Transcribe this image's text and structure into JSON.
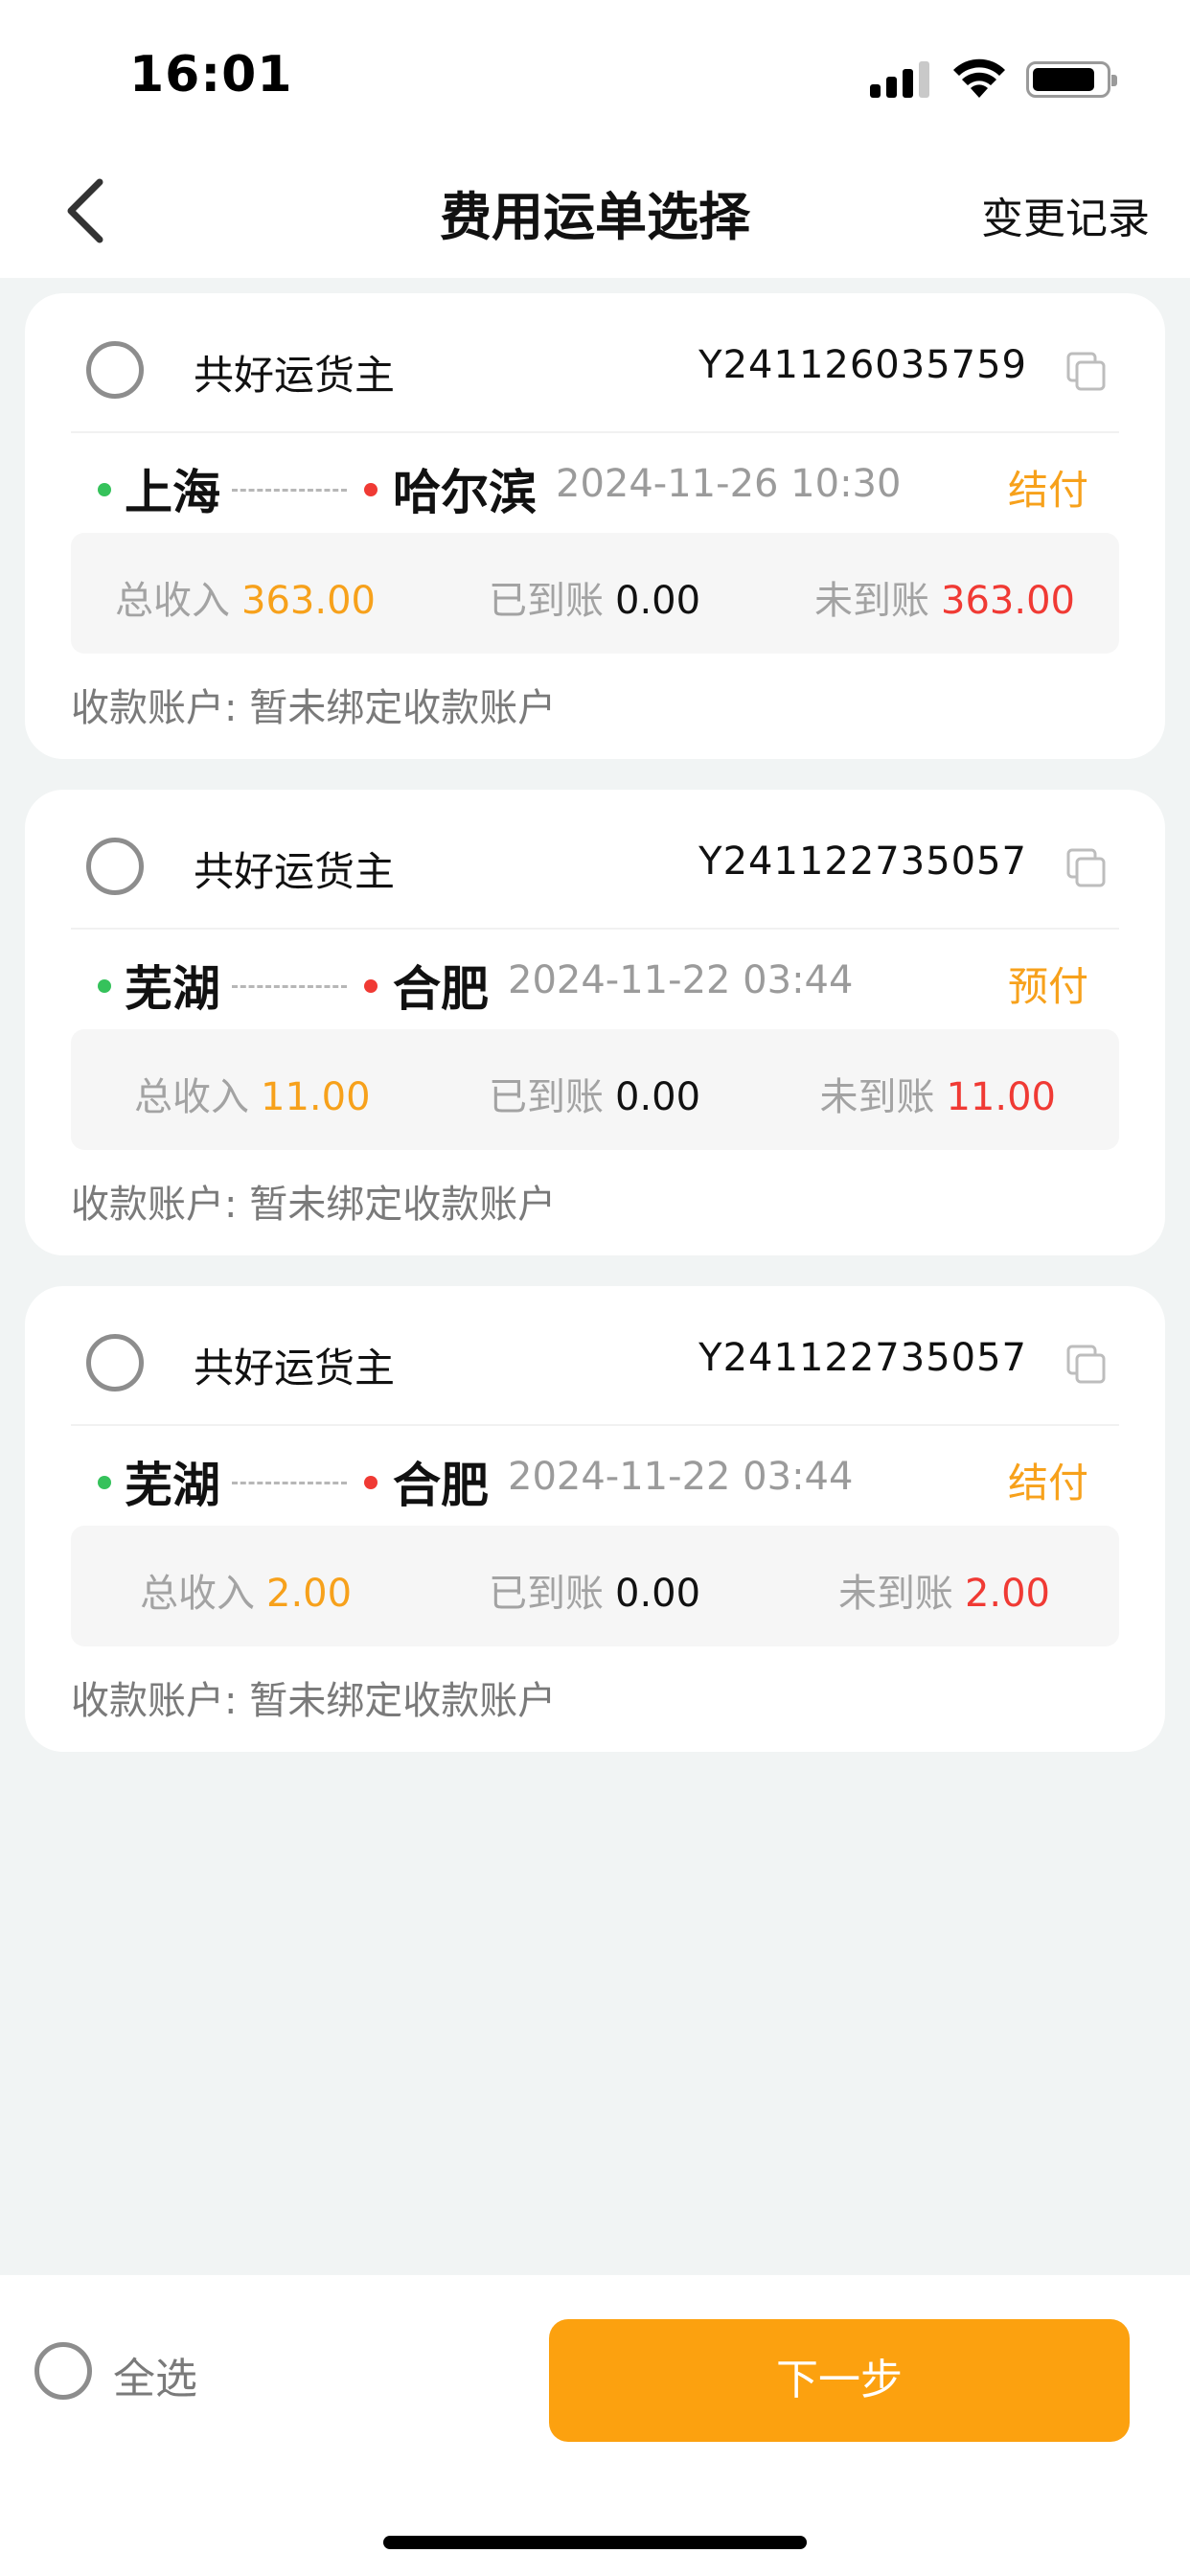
{
  "status_bar": {
    "time": "16:01"
  },
  "nav": {
    "title": "费用运单选择",
    "action_label": "变更记录",
    "back_icon": "chevron-left-icon"
  },
  "orders": [
    {
      "shipper": "共好运货主",
      "waybill_no": "Y241126035759",
      "origin": "上海",
      "destination": "哈尔滨",
      "route_dash": "-----",
      "datetime": "2024-11-26 10:30",
      "pay_type": "结付",
      "total_label": "总收入",
      "total_value": "363.00",
      "received_label": "已到账",
      "received_value": "0.00",
      "pending_label": "未到账",
      "pending_value": "363.00",
      "account_text": "收款账户: 暂未绑定收款账户"
    },
    {
      "shipper": "共好运货主",
      "waybill_no": "Y241122735057",
      "origin": "芜湖",
      "destination": "合肥",
      "route_dash": "-----",
      "datetime": "2024-11-22 03:44",
      "pay_type": "预付",
      "total_label": "总收入",
      "total_value": "11.00",
      "received_label": "已到账",
      "received_value": "0.00",
      "pending_label": "未到账",
      "pending_value": "11.00",
      "account_text": "收款账户: 暂未绑定收款账户"
    },
    {
      "shipper": "共好运货主",
      "waybill_no": "Y241122735057",
      "origin": "芜湖",
      "destination": "合肥",
      "route_dash": "-----",
      "datetime": "2024-11-22 03:44",
      "pay_type": "结付",
      "total_label": "总收入",
      "total_value": "2.00",
      "received_label": "已到账",
      "received_value": "0.00",
      "pending_label": "未到账",
      "pending_value": "2.00",
      "account_text": "收款账户: 暂未绑定收款账户"
    }
  ],
  "bottom": {
    "select_all_label": "全选",
    "next_label": "下一步"
  },
  "colors": {
    "accent": "#fca10f",
    "amount_orange": "#f7a11b",
    "amount_red": "#f03a34",
    "origin_dot": "#35c25b",
    "destination_dot": "#f03a34",
    "background": "#f1f4f4"
  }
}
